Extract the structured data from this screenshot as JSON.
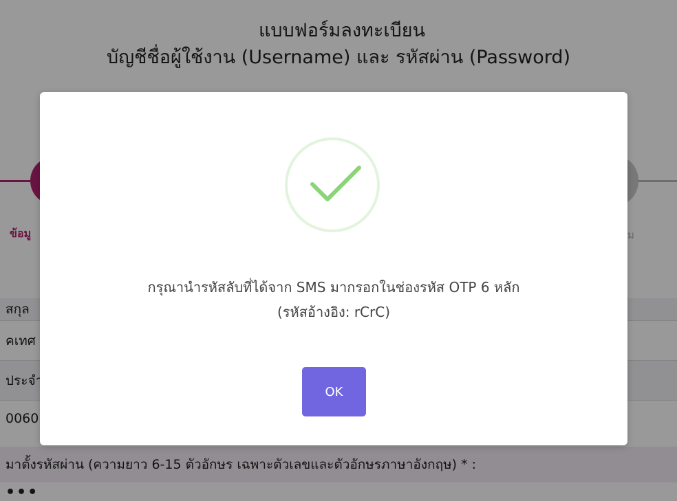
{
  "page": {
    "title_line1": "แบบฟอร์มลงทะเบียน",
    "title_line2": "บัญชีชื่อผู้ใช้งาน (Username) และ รหัสผ่าน (Password)"
  },
  "stepper": {
    "step1_label_visible": "ข้อมู",
    "step_last_label_visible": "ม",
    "active_color": "#b0226f",
    "inactive_color": "#c9c9c9"
  },
  "form": {
    "lastname_label_visible": "สกุล",
    "lastname_value_visible": "คเทศ",
    "id_label_visible": "ประจำ",
    "id_value_visible": "0060",
    "password_label_visible": "มาตั้งรหัสผ่าน (ความยาว 6-15 ตัวอักษร เฉพาะตัวเลขและตัวอักษรภาษาอังกฤษ) * :",
    "password_value_visible": "•••"
  },
  "modal": {
    "icon": "success-check-icon",
    "message_line1": "กรุณานำรหัสลับที่ได้จาก SMS มากรอกในช่องรหัส OTP 6 หลัก",
    "message_line2": "(รหัสอ้างอิง: rCrC)",
    "ok_label": "OK",
    "ok_color": "#7166e0",
    "check_color": "#8cd478"
  }
}
